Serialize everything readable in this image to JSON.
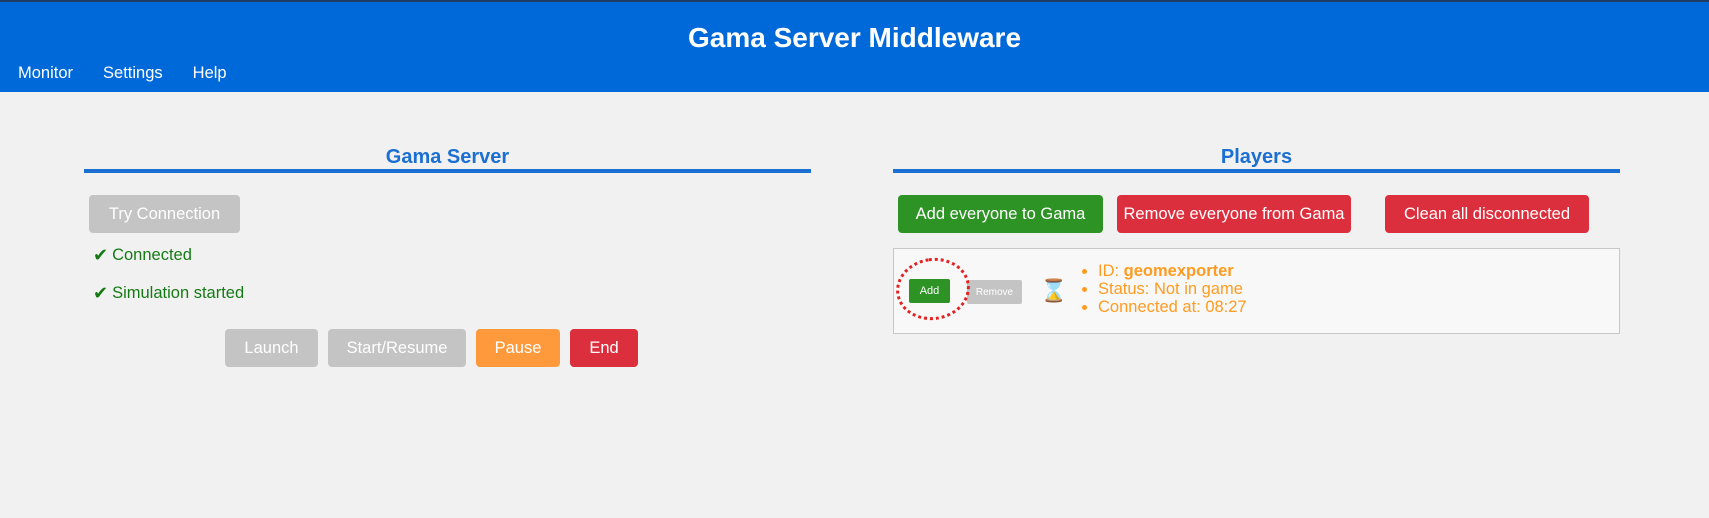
{
  "header": {
    "title": "Gama Server Middleware",
    "nav": [
      "Monitor",
      "Settings",
      "Help"
    ]
  },
  "gama_server": {
    "title": "Gama Server",
    "try_connection": "Try Connection",
    "status": [
      "Connected",
      "Simulation started"
    ],
    "status_icon": "✔",
    "controls": {
      "launch": "Launch",
      "start_resume": "Start/Resume",
      "pause": "Pause",
      "end": "End"
    }
  },
  "players": {
    "title": "Players",
    "add_all": "Add everyone to Gama",
    "remove_all": "Remove everyone from Gama",
    "clean_disconnected": "Clean all disconnected",
    "list": [
      {
        "add_label": "Add",
        "remove_label": "Remove",
        "hourglass": "⌛",
        "id_label": "ID: ",
        "id": "geomexporter",
        "status": "Status: Not in game",
        "connected": "Connected at: 08:27"
      }
    ]
  },
  "colors": {
    "header": "#0069d9",
    "accent": "#1b6fd2",
    "green": "#2c9324",
    "red": "#dc2f3d",
    "orange": "#ff9a3c",
    "gray": "#c4c4c4",
    "player_text": "#ff9b1f"
  }
}
